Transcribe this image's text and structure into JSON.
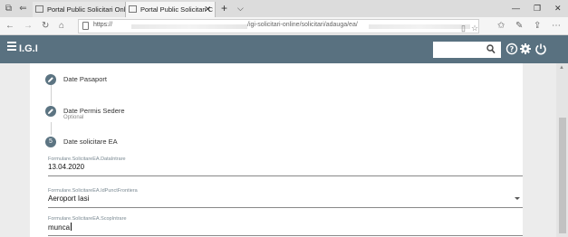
{
  "browser": {
    "tabs": [
      {
        "label": "Portal Public Solicitari Onlin"
      },
      {
        "label": "Portal Public Solicitari C"
      }
    ],
    "address": {
      "prefix": "https://",
      "path": "/igi-solicitari-online/solicitari/adauga/ea/"
    }
  },
  "app": {
    "title": "I.G.I",
    "search": {
      "placeholder": "",
      "value": ""
    }
  },
  "steps": [
    {
      "title": "Date Pasaport",
      "subtitle": ""
    },
    {
      "title": "Date Permis Sedere",
      "subtitle": "Optional"
    },
    {
      "number": "5",
      "title": "Date solicitare EA"
    }
  ],
  "form": {
    "fields": [
      {
        "label": "Formulare.SolicitareEA.DataIntrare",
        "value": "13.04.2020"
      },
      {
        "label": "Formulare.SolicitareEA.IdPunctFrontiera",
        "value": "Aeroport Iasi"
      },
      {
        "label": "Formulare.SolicitareEA.ScopIntrare",
        "value": "munca"
      }
    ]
  },
  "colors": {
    "header": "#597180",
    "step": "#5c7482"
  }
}
